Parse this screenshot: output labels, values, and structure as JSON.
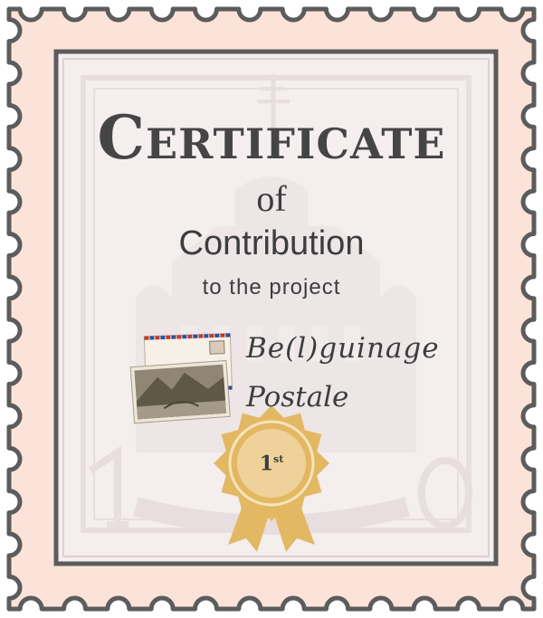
{
  "certificate": {
    "title": "Certificate",
    "of": "of",
    "contribution": "Contribution",
    "project_intro": "to the project",
    "project_name_line1": "Be(l)guinage",
    "project_name_line2": "Postale",
    "rank_number": "1",
    "rank_suffix": "st"
  },
  "colors": {
    "stamp_background": "#fbe3d9",
    "border_gray": "#5c5c5c",
    "inner_panel": "#f4eeee",
    "watermark": "#dfd0d4",
    "medal_gold": "#e3b862",
    "medal_center": "#efd29a",
    "airmail_red": "#c0392b",
    "airmail_blue": "#2e4f9b"
  },
  "icons": [
    "perforated-stamp-frame",
    "postcard-photo-icon",
    "airmail-envelope-icon",
    "rosette-medal-icon"
  ]
}
